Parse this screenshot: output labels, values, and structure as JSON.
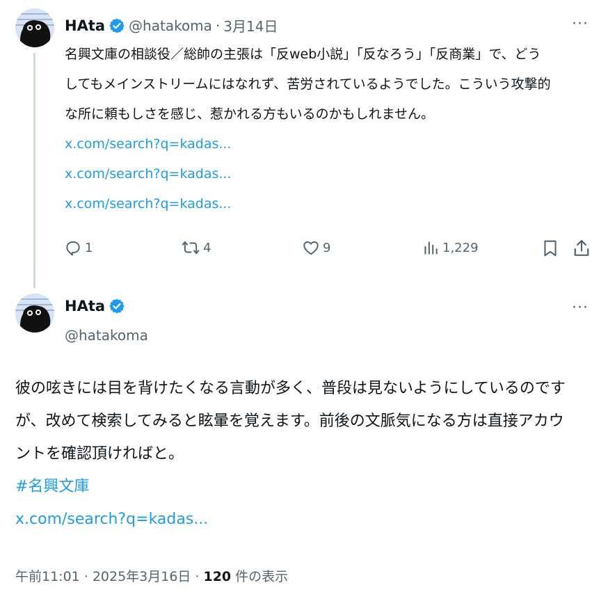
{
  "tweet1": {
    "name": "HAta",
    "handle": "@hatakoma",
    "date": "3月14日",
    "separator": "·",
    "more": "···",
    "text_lines": [
      "名興文庫の相談役／総帥の主張は「反web小説」「反なろう」「反商業」で、どう",
      "してもメインストリームにはなれず、苦労されているようでした。こういう攻撃的",
      "な所に頼もしさを感じ、惹かれる方もいるのかもしれません。"
    ],
    "links": [
      "x.com/search?q=kadas...",
      "x.com/search?q=kadas...",
      "x.com/search?q=kadas..."
    ],
    "actions": {
      "reply_count": "1",
      "retweet_count": "4",
      "like_count": "9",
      "views_count": "1,229"
    }
  },
  "tweet2": {
    "name": "HAta",
    "handle": "@hatakoma",
    "more": "···",
    "text_lines": [
      "彼の呟きには目を背けたくなる言動が多く、普段は見ないようにしているのです",
      "が、改めて検索してみると眩暈を覚えます。前後の文脈気になる方は直接アカウ",
      "ントを確認頂ければと。"
    ],
    "hashtag": "#名興文庫",
    "link": "x.com/search?q=kadas...",
    "meta": {
      "time": "午前11:01",
      "sep1": "·",
      "date": "2025年3月16日",
      "sep2": "·",
      "views": "120",
      "views_label": "件の表示"
    }
  },
  "colors": {
    "link": "#1d9bf0",
    "secondary_text": "#536471",
    "verified": "#1d9bf0",
    "thread_line": "#cfd9de"
  }
}
